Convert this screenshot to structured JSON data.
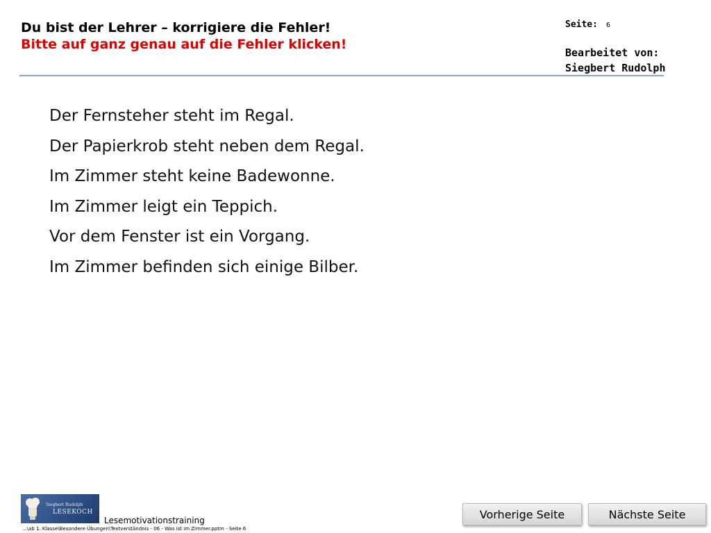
{
  "header": {
    "title": "Du bist der Lehrer – korrigiere die Fehler!",
    "instruction": "Bitte auf ganz genau auf die Fehler klicken!",
    "page_label": "Seite:",
    "page_number": "6",
    "edited_by_label": "Bearbeitet von:",
    "editor_name": "Siegbert Rudolph"
  },
  "sentences": [
    "Der Fernsteher steht im Regal.",
    "Der Papierkrob steht neben dem Regal.",
    "Im Zimmer steht keine Badewonne.",
    "Im Zimmer leigt ein Teppich.",
    "Vor dem Fenster ist ein Vorgang.",
    "Im Zimmer befinden sich einige Bilber."
  ],
  "footer": {
    "logo_author": "Siegbert Rudolph",
    "logo_brand": "LESEKOCH",
    "program_title": "Lesemotivationstraining",
    "file_path": "...\\ab 1. Klasse\\Besondere Übungen\\Textverständnis - 06 - Was ist im Zimmer.pptm - Seite 6"
  },
  "navigation": {
    "prev_label": "Vorherige Seite",
    "next_label": "Nächste Seite"
  },
  "colors": {
    "instruction": "#e00000",
    "rule": "#8aa4c8",
    "logo_background": "#2c4f86"
  }
}
